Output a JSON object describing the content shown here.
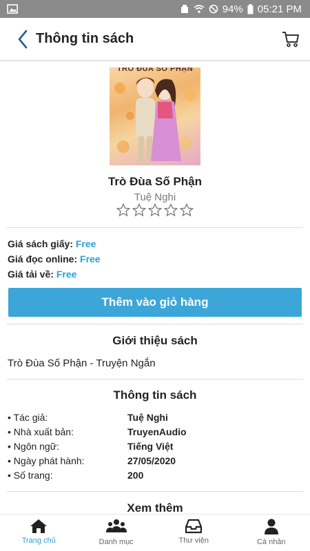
{
  "status_bar": {
    "battery": "94%",
    "time": "05:21 PM"
  },
  "header": {
    "title": "Thông tin sách",
    "back_icon": "chevron-left-icon",
    "cart_icon": "cart-icon",
    "accent_color": "#1f5f8b"
  },
  "book": {
    "cover_text": "TRÒ ĐÙA SỐ PHẬN",
    "title": "Trò Đùa Số Phận",
    "author": "Tuệ Nghi",
    "rating_stars": 5,
    "rating_value": 0
  },
  "prices": [
    {
      "label": "Giá sách giấy:",
      "value": "Free"
    },
    {
      "label": "Giá đọc online:",
      "value": "Free"
    },
    {
      "label": "Giá tải về:",
      "value": "Free"
    }
  ],
  "add_to_cart_label": "Thêm vào giỏ hàng",
  "intro": {
    "heading": "Giới thiệu sách",
    "text": "Trò Đùa Số Phận - Truyện Ngắn"
  },
  "info": {
    "heading": "Thông tin sách",
    "rows": [
      {
        "label": "• Tác giả:",
        "value": "Tuệ Nghi"
      },
      {
        "label": "• Nhà xuất bản:",
        "value": "TruyenAudio"
      },
      {
        "label": "• Ngôn ngữ:",
        "value": "Tiếng Việt"
      },
      {
        "label": "• Ngày phát hành:",
        "value": "27/05/2020"
      },
      {
        "label": "• Số trang:",
        "value": "200"
      }
    ]
  },
  "more": {
    "heading": "Xem thêm"
  },
  "bottom_nav": [
    {
      "label": "Trang chủ",
      "icon": "home-icon",
      "active": true
    },
    {
      "label": "Danh mục",
      "icon": "group-icon",
      "active": false
    },
    {
      "label": "Thư viện",
      "icon": "inbox-icon",
      "active": false
    },
    {
      "label": "Cá nhân",
      "icon": "user-icon",
      "active": false
    }
  ],
  "colors": {
    "primary_button": "#3ca6d8",
    "price_value": "#2aa0d4",
    "active_nav": "#2aa0d4",
    "status_bar": "#8a8a8a"
  }
}
